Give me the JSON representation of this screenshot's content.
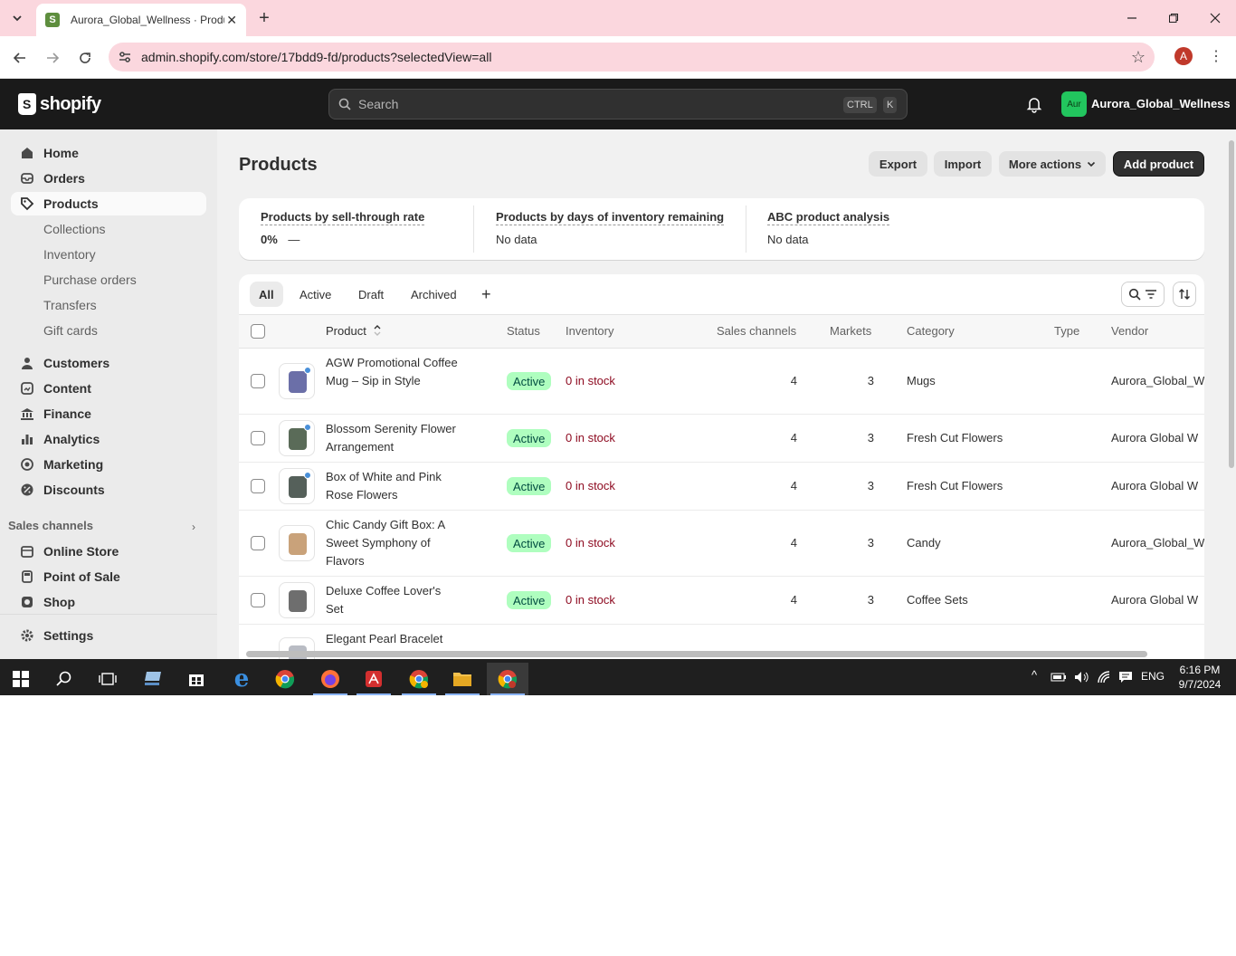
{
  "browser": {
    "tab_title": "Aurora_Global_Wellness · Products · Shopify",
    "url": "admin.shopify.com/store/17bdd9-fd/products?selectedView=all",
    "profile_initial": "A"
  },
  "topbar": {
    "logo_text": "shopify",
    "search_placeholder": "Search",
    "shortcut_ctrl": "CTRL",
    "shortcut_key": "K",
    "store_avatar": "Aur",
    "store_name": "Aurora_Global_Wellness"
  },
  "sidebar": {
    "items": [
      {
        "label": "Home",
        "icon": "home-icon"
      },
      {
        "label": "Orders",
        "icon": "orders-icon"
      },
      {
        "label": "Products",
        "icon": "tag-icon"
      },
      {
        "label": "Customers",
        "icon": "person-icon"
      },
      {
        "label": "Content",
        "icon": "content-icon"
      },
      {
        "label": "Finance",
        "icon": "bank-icon"
      },
      {
        "label": "Analytics",
        "icon": "chart-icon"
      },
      {
        "label": "Marketing",
        "icon": "target-icon"
      },
      {
        "label": "Discounts",
        "icon": "discount-icon"
      }
    ],
    "product_subitems": [
      "Collections",
      "Inventory",
      "Purchase orders",
      "Transfers",
      "Gift cards"
    ],
    "sales_channels_label": "Sales channels",
    "channels": [
      {
        "label": "Online Store",
        "icon": "store-icon"
      },
      {
        "label": "Point of Sale",
        "icon": "pos-icon"
      },
      {
        "label": "Shop",
        "icon": "shop-icon"
      }
    ],
    "settings_label": "Settings"
  },
  "page": {
    "title": "Products",
    "export_label": "Export",
    "import_label": "Import",
    "more_actions_label": "More actions",
    "add_product_label": "Add product"
  },
  "metrics": [
    {
      "title": "Products by sell-through rate",
      "value": "0%",
      "extra": "—"
    },
    {
      "title": "Products by days of inventory remaining",
      "value": "No data"
    },
    {
      "title": "ABC product analysis",
      "value": "No data"
    }
  ],
  "view_tabs": [
    "All",
    "Active",
    "Draft",
    "Archived"
  ],
  "table": {
    "headers": {
      "product": "Product",
      "status": "Status",
      "inventory": "Inventory",
      "sales_channels": "Sales channels",
      "markets": "Markets",
      "category": "Category",
      "type": "Type",
      "vendor": "Vendor"
    },
    "rows": [
      {
        "name": "AGW Promotional Coffee Mug – Sip in Style",
        "status": "Active",
        "inventory": "0 in stock",
        "sales_channels": "4",
        "markets": "3",
        "category": "Mugs",
        "type": "",
        "vendor": "Aurora_Global_W",
        "thumb_color": "#6b6fa8"
      },
      {
        "name": "Blossom Serenity Flower Arrangement",
        "status": "Active",
        "inventory": "0 in stock",
        "sales_channels": "4",
        "markets": "3",
        "category": "Fresh Cut Flowers",
        "type": "",
        "vendor": "Aurora Global W",
        "thumb_color": "#5a6b58"
      },
      {
        "name": "Box of White and Pink Rose Flowers",
        "status": "Active",
        "inventory": "0 in stock",
        "sales_channels": "4",
        "markets": "3",
        "category": "Fresh Cut Flowers",
        "type": "",
        "vendor": "Aurora Global W",
        "thumb_color": "#55605a"
      },
      {
        "name": "Chic Candy Gift Box: A Sweet Symphony of Flavors",
        "status": "Active",
        "inventory": "0 in stock",
        "sales_channels": "4",
        "markets": "3",
        "category": "Candy",
        "type": "",
        "vendor": "Aurora_Global_W",
        "thumb_color": "#c9a27a"
      },
      {
        "name": "Deluxe Coffee Lover's Set",
        "status": "Active",
        "inventory": "0 in stock",
        "sales_channels": "4",
        "markets": "3",
        "category": "Coffee Sets",
        "type": "",
        "vendor": "Aurora Global W",
        "thumb_color": "#6e6e6e"
      },
      {
        "name": "Elegant Pearl Bracelet",
        "status": "",
        "inventory": "",
        "sales_channels": "",
        "markets": "",
        "category": "",
        "type": "",
        "vendor": "",
        "thumb_color": "#b9bcc4"
      }
    ]
  },
  "taskbar": {
    "language": "ENG",
    "time": "6:16 PM",
    "date": "9/7/2024"
  }
}
